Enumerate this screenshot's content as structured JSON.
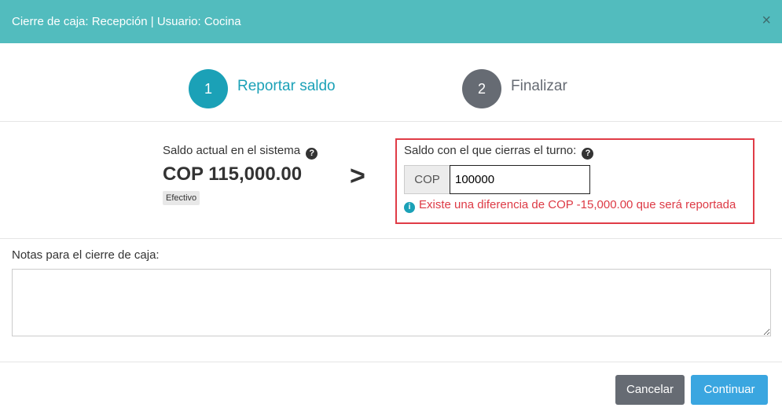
{
  "header": {
    "title": "Cierre de caja: Recepción | Usuario: Cocina",
    "close_glyph": "×"
  },
  "steps": [
    {
      "number": "1",
      "label": "Reportar saldo",
      "state": "active"
    },
    {
      "number": "2",
      "label": "Finalizar",
      "state": "pending"
    }
  ],
  "system_balance": {
    "label": "Saldo actual en el sistema",
    "amount": "COP 115,000.00",
    "badge": "Efectivo"
  },
  "arrow": ">",
  "closing_balance": {
    "label": "Saldo con el que cierras el turno:",
    "currency": "COP",
    "value": "100000",
    "warning": "Existe una diferencia de COP -15,000.00 que será reportada"
  },
  "notes": {
    "label": "Notas para el cierre de caja:",
    "value": ""
  },
  "buttons": {
    "cancel": "Cancelar",
    "continue": "Continuar"
  },
  "icons": {
    "help": "question-circle-icon",
    "info": "info-circle-icon",
    "close": "close-icon"
  },
  "colors": {
    "header_bg": "#52bcbe",
    "step_active": "#1ba1b7",
    "step_pending": "#666b73",
    "warning": "#dd3a45",
    "primary_button": "#3aa6e0",
    "secondary_button": "#666b73"
  }
}
